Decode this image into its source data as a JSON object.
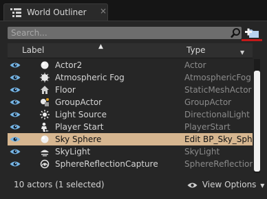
{
  "tab": {
    "title": "World Outliner",
    "close": "×",
    "icon": "outliner-list-icon"
  },
  "search": {
    "placeholder": "Search...",
    "icon": "magnifier-icon"
  },
  "toolbar": {
    "add_folder_icon": "add-folder-icon"
  },
  "columns": {
    "label": "Label",
    "type": "Type"
  },
  "rows": [
    {
      "name": "Actor2",
      "type": "Actor",
      "icon": "sphere-icon",
      "selected": false
    },
    {
      "name": "Atmospheric Fog",
      "type": "AtmosphericFog",
      "icon": "fog-icon",
      "selected": false
    },
    {
      "name": "Floor",
      "type": "StaticMeshActor",
      "icon": "house-icon",
      "selected": false
    },
    {
      "name": "GroupActor",
      "type": "GroupActor",
      "icon": "group-icon",
      "selected": false
    },
    {
      "name": "Light Source",
      "type": "DirectionalLight",
      "icon": "sun-icon",
      "selected": false
    },
    {
      "name": "Player Start",
      "type": "PlayerStart",
      "icon": "player-start-icon",
      "selected": false
    },
    {
      "name": "Sky Sphere",
      "type": "Edit BP_Sky_Sph",
      "icon": "sphere-icon",
      "selected": true
    },
    {
      "name": "SkyLight",
      "type": "SkyLight",
      "icon": "skylight-icon",
      "selected": false
    },
    {
      "name": "SphereReflectionCapture",
      "type": "SphereReflectionC",
      "icon": "reflection-capture-icon",
      "selected": false
    }
  ],
  "footer": {
    "status": "10 actors (1 selected)",
    "view_options": "View Options"
  },
  "colors": {
    "selection": "#d6b690",
    "eye": "#76b6e6",
    "accent_red": "#c41a1a",
    "search_bg": "#6d6d6d"
  }
}
